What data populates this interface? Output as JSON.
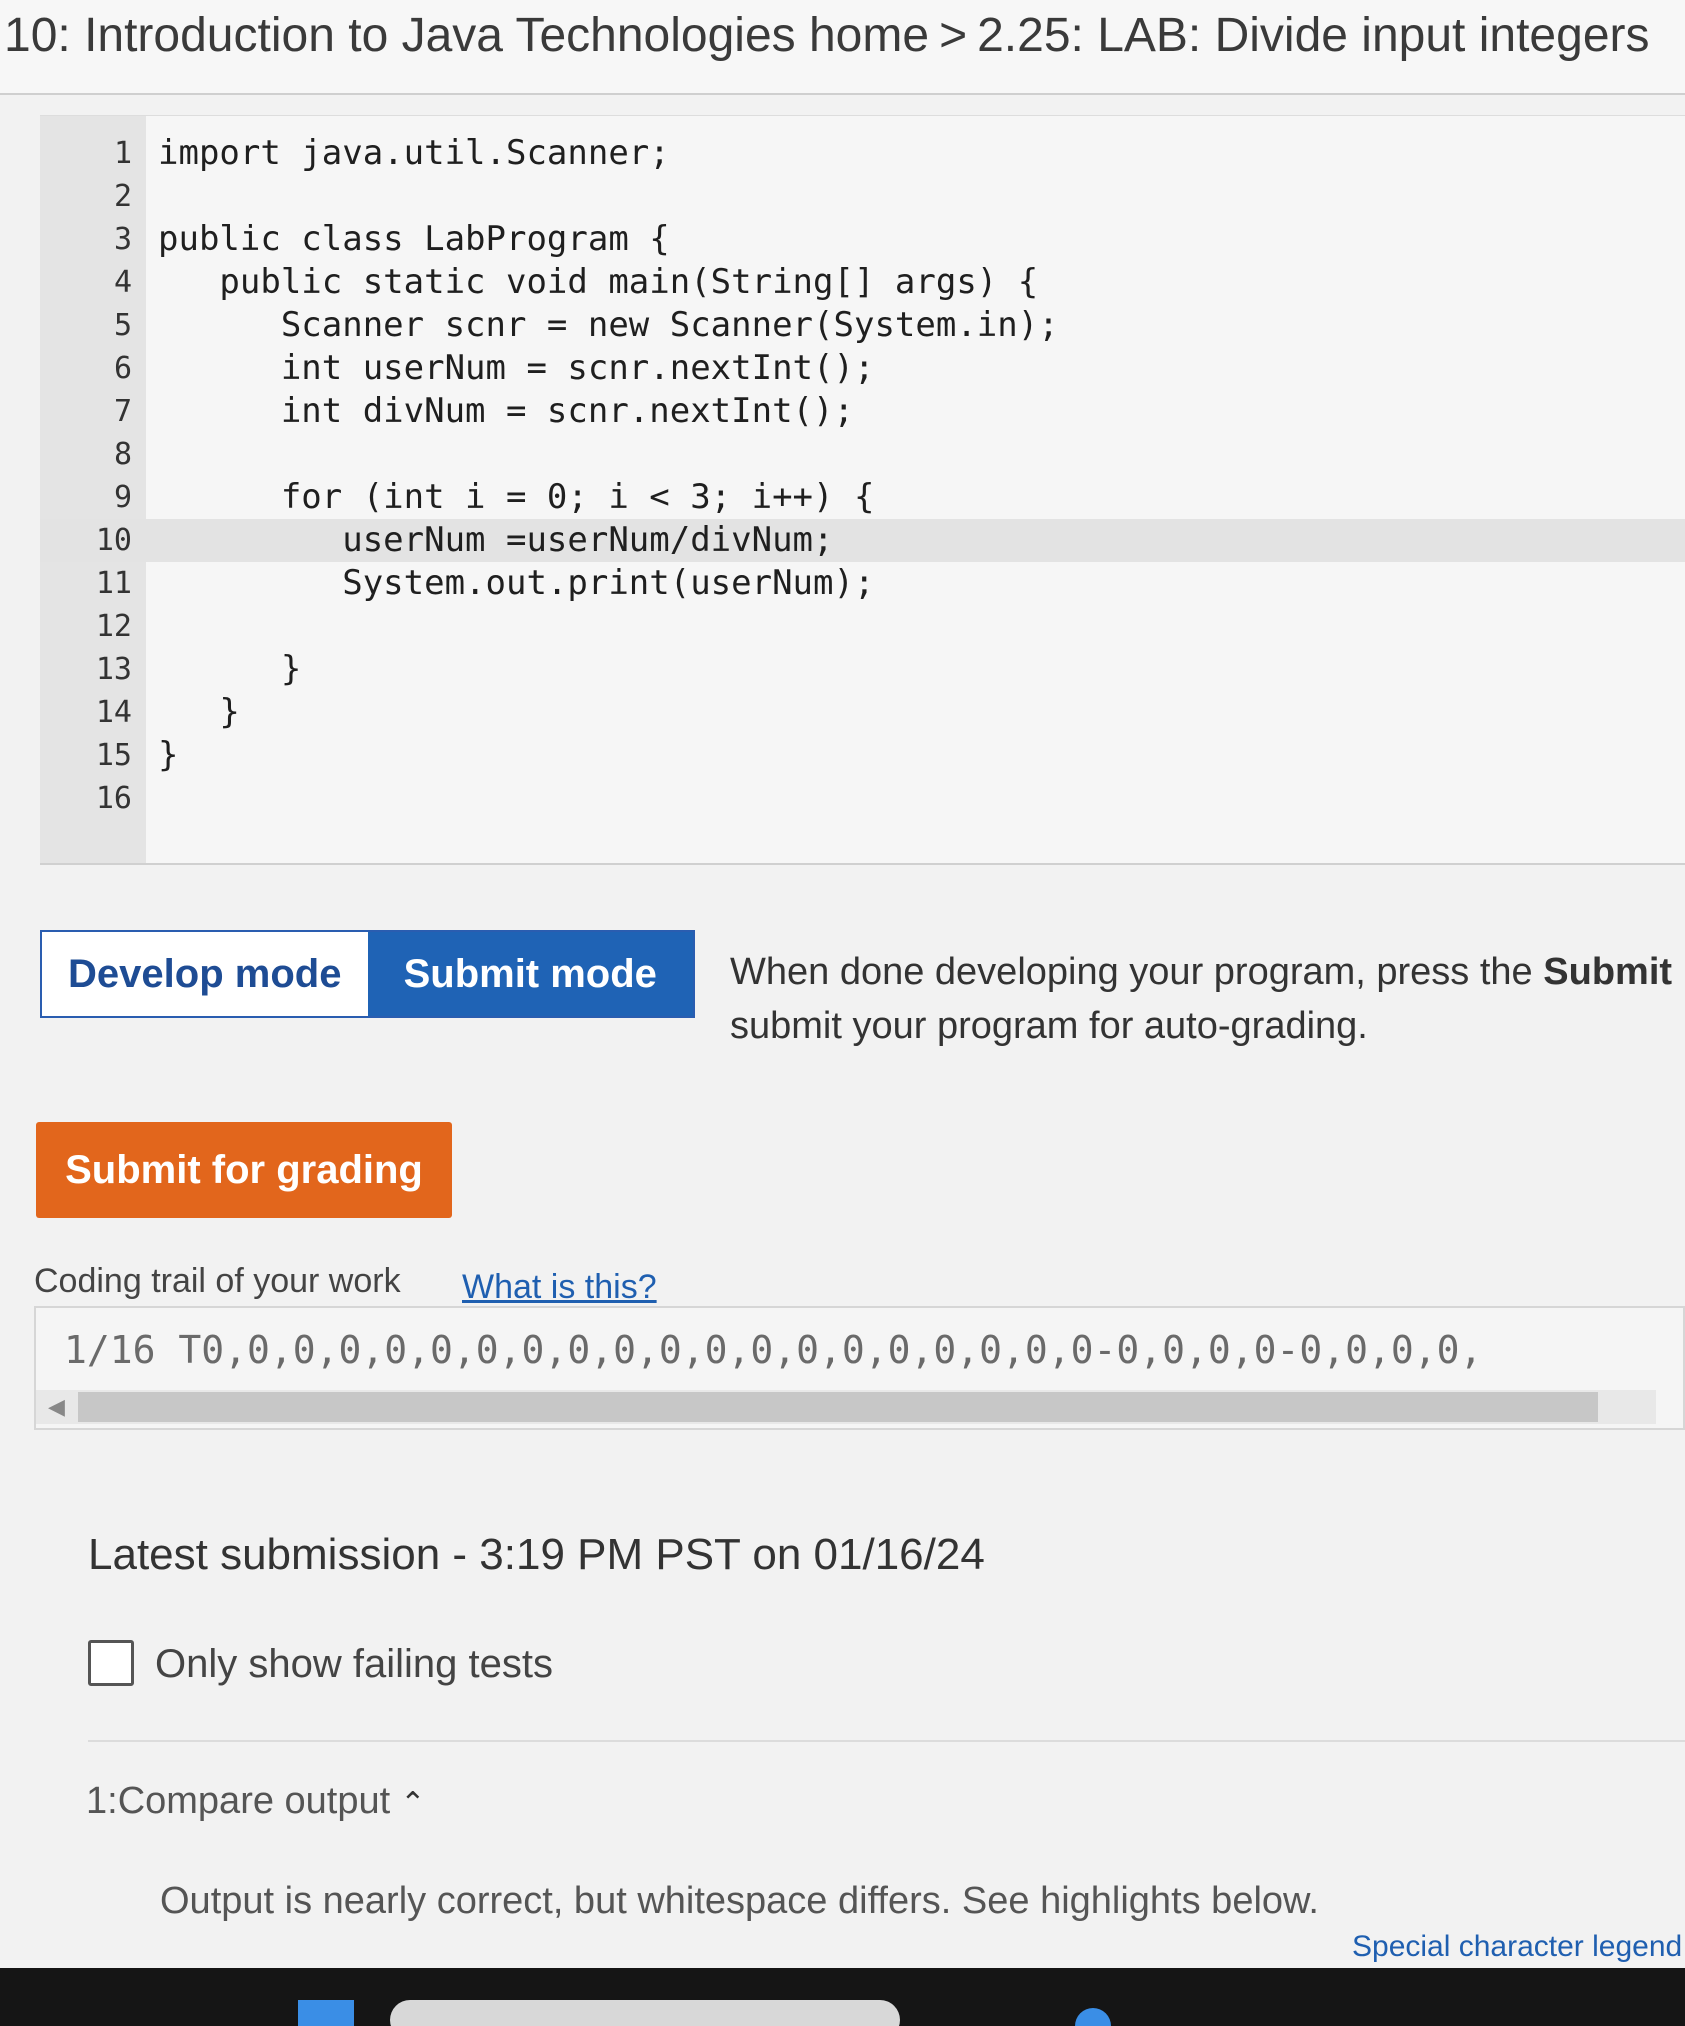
{
  "header": {
    "section": "10: Introduction to Java Technologies home",
    "separator": ">",
    "current": "2.25: LAB: Divide input integers"
  },
  "editor": {
    "lines": [
      {
        "num": "1",
        "code": "import java.util.Scanner;"
      },
      {
        "num": "2",
        "code": ""
      },
      {
        "num": "3",
        "code": "public class LabProgram {"
      },
      {
        "num": "4",
        "code": "   public static void main(String[] args) {"
      },
      {
        "num": "5",
        "code": "      Scanner scnr = new Scanner(System.in);"
      },
      {
        "num": "6",
        "code": "      int userNum = scnr.nextInt();"
      },
      {
        "num": "7",
        "code": "      int divNum = scnr.nextInt();"
      },
      {
        "num": "8",
        "code": ""
      },
      {
        "num": "9",
        "code": "      for (int i = 0; i < 3; i++) {"
      },
      {
        "num": "10",
        "code": "         userNum =userNum/divNum;"
      },
      {
        "num": "11",
        "code": "         System.out.print(userNum);"
      },
      {
        "num": "12",
        "code": ""
      },
      {
        "num": "13",
        "code": "      }"
      },
      {
        "num": "14",
        "code": "   }"
      },
      {
        "num": "15",
        "code": "}"
      },
      {
        "num": "16",
        "code": ""
      }
    ],
    "active_line": "10"
  },
  "mode": {
    "develop_label": "Develop mode",
    "submit_label": "Submit mode",
    "hint_prefix": "When done developing your program, press the ",
    "hint_bold": "Submit",
    "hint_suffix": " submit your program for auto-grading."
  },
  "grading": {
    "submit_label": "Submit for grading"
  },
  "trail": {
    "label": "Coding trail of your work",
    "link": "What is this?",
    "text": "1/16 T0,0,0,0,0,0,0,0,0,0,0,0,0,0,0,0,0,0,0,0-0,0,0,0-0,0,0,0,"
  },
  "submission": {
    "title": "Latest submission - 3:19 PM PST on 01/16/24",
    "filter_label": "Only show failing tests",
    "test_title": "1:Compare output",
    "test_message": "Output is nearly correct, but whitespace differs. See highlights below.",
    "legend_link": "Special character legend"
  },
  "colors": {
    "submit_mode": "#1f63b5",
    "grade_button": "#e2661c",
    "link": "#1f5fb0"
  }
}
